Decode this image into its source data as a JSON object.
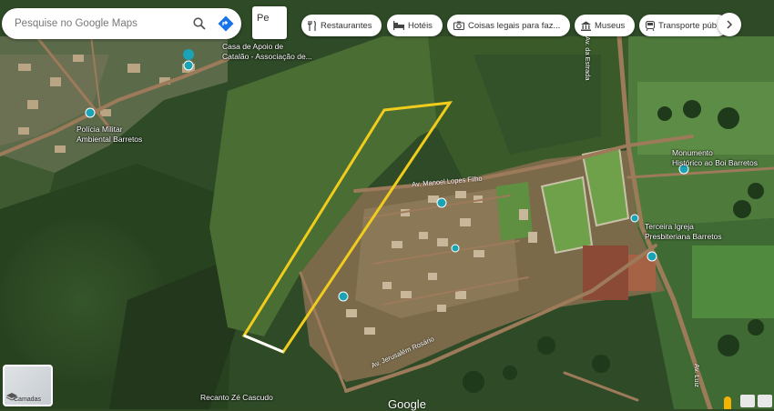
{
  "search": {
    "placeholder": "Pesquise no Google Maps"
  },
  "layer_button": {
    "label": "Pe"
  },
  "chips": [
    {
      "label": "Restaurantes",
      "icon": "fork-knife-icon"
    },
    {
      "label": "Hotéis",
      "icon": "bed-icon"
    },
    {
      "label": "Coisas legais para faz...",
      "icon": "camera-icon"
    },
    {
      "label": "Museus",
      "icon": "museum-icon"
    },
    {
      "label": "Transporte púb",
      "icon": "transit-icon"
    }
  ],
  "places": [
    "Casa de Apoio de",
    "Catalão - Associação de...",
    "Polícia Militar",
    "Ambiental Barretos",
    "Recanto Zé Cascudo"
  ],
  "poi_labels": [
    "Monumento",
    "Histórico ao Boi Barretos",
    "Terceira Igreja",
    "Presbiteriana Barretos"
  ],
  "roads": [
    "Av. Manoel Lopes Filho",
    "Av. Jerusalém Rosário",
    "Av. da Estrada",
    "Av. Luiz"
  ],
  "layers_tile": {
    "label": "Camadas"
  },
  "brand": "Google",
  "colors": {
    "boundary": "#f2cc1c",
    "boundary_base": "#ffffff",
    "poi_teal": "#1aa3b5"
  }
}
